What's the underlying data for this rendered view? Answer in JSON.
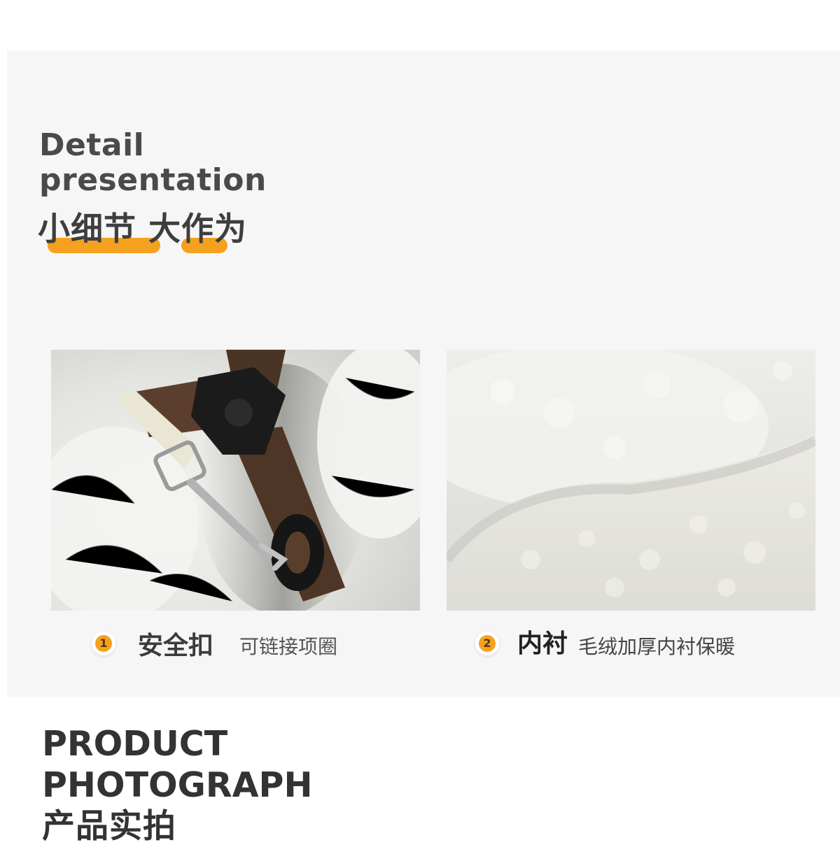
{
  "header": {
    "title_en_line1": "Detail",
    "title_en_line2": "presentation",
    "title_cn": "小细节 大作为"
  },
  "accent_color": "#f5a11f",
  "details": [
    {
      "number": "1",
      "title": "安全扣",
      "description": "可链接项圈"
    },
    {
      "number": "2",
      "title": "内衬",
      "description": "毛绒加厚内衬保暖"
    }
  ],
  "footer": {
    "line1": "PRODUCT",
    "line2": "PHOTOGRAPH",
    "line3": "产品实拍"
  }
}
